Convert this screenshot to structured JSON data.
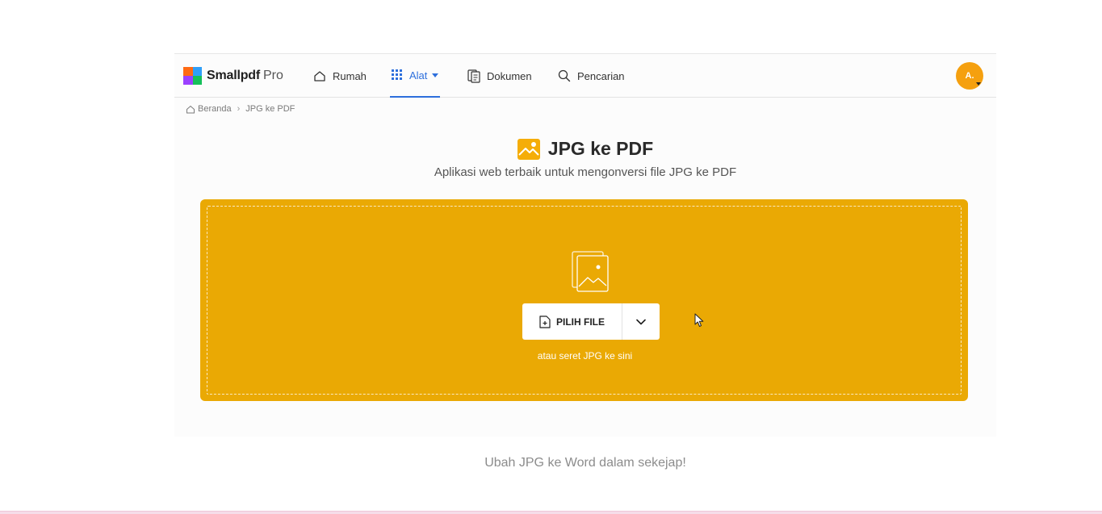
{
  "brand": {
    "name": "Smallpdf",
    "tier": "Pro"
  },
  "nav": {
    "items": [
      {
        "label": "Rumah",
        "icon": "home-icon"
      },
      {
        "label": "Alat",
        "icon": "grid-icon",
        "active": true
      },
      {
        "label": "Dokumen",
        "icon": "documents-icon"
      },
      {
        "label": "Pencarian",
        "icon": "search-icon"
      }
    ],
    "avatar_initials": "A."
  },
  "breadcrumb": {
    "home": "Beranda",
    "current": "JPG ke PDF"
  },
  "hero": {
    "title": "JPG ke PDF",
    "subtitle": "Aplikasi web terbaik untuk mengonversi file JPG ke PDF"
  },
  "dropzone": {
    "button_label": "PILIH FILE",
    "hint": "atau seret JPG ke sini"
  },
  "footer": {
    "text": "Ubah JPG ke Word dalam sekejap!"
  },
  "colors": {
    "accent": "#2d6fdc",
    "dropzone": "#eaa904",
    "avatar": "#f5a00f"
  }
}
